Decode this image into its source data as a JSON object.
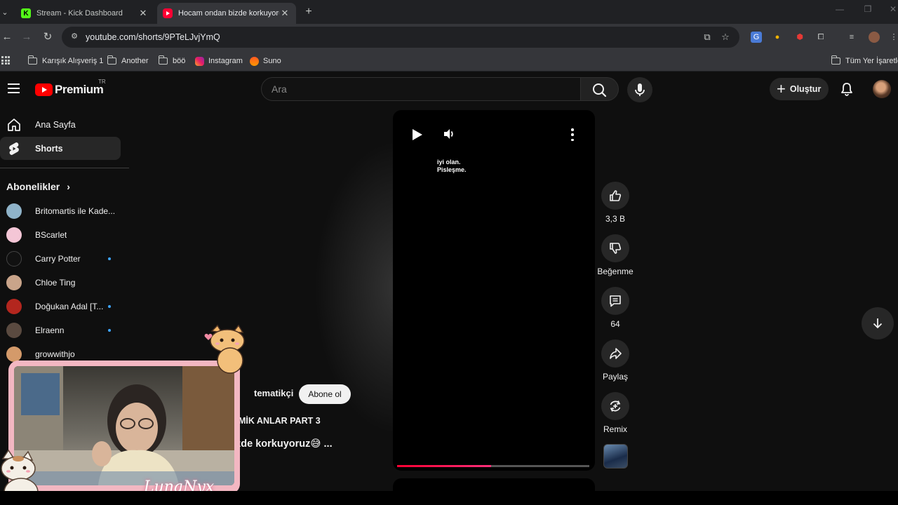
{
  "browser": {
    "tabs": [
      {
        "title": "Stream - Kick Dashboard",
        "active": false
      },
      {
        "title": "Hocam ondan bizde korkuyoruz",
        "active": true
      }
    ],
    "url": "youtube.com/shorts/9PTeLJvjYmQ",
    "bookmarks": [
      "Karışık Alışveriş 1",
      "Another",
      "böö",
      "Instagram",
      "Suno"
    ],
    "bookmarks_right": "Tüm Yer İşaretleri"
  },
  "youtube": {
    "logo_text": "Premium",
    "country_code": "TR",
    "search_placeholder": "Ara",
    "create_label": "Oluştur",
    "nav": [
      {
        "label": "Ana Sayfa",
        "icon": "home-icon",
        "active": false
      },
      {
        "label": "Shorts",
        "icon": "shorts-icon",
        "active": true
      }
    ],
    "subscriptions_heading": "Abonelikler",
    "subscriptions": [
      {
        "name": "Britomartis ile Kade...",
        "color": "#8fb3c9",
        "new": false
      },
      {
        "name": "BScarlet",
        "color": "#f4c6d6",
        "new": false
      },
      {
        "name": "Carry Potter",
        "color": "#111111",
        "new": true
      },
      {
        "name": "Chloe Ting",
        "color": "#c9a48a",
        "new": false
      },
      {
        "name": "Doğukan Adal [T...",
        "color": "#b3261e",
        "new": true
      },
      {
        "name": "Elraenn",
        "color": "#5a4a40",
        "new": true
      },
      {
        "name": "growwithjo",
        "color": "#d49a6a",
        "new": false
      }
    ],
    "short": {
      "caption_line1": "iyi olan.",
      "caption_line2": "Pisleşme.",
      "progress": 0.49,
      "channel": "tematikçi",
      "subscribe_label": "Abone ol",
      "playlist": "MİK ANLAR PART 3",
      "title": "izde korkuyoruz😅 ..."
    },
    "actions": {
      "like_count": "3,3 B",
      "dislike_label": "Beğenme",
      "comment_count": "64",
      "share_label": "Paylaş",
      "remix_label": "Remix"
    }
  },
  "overlay": {
    "streamer_signature": "LunaNyx"
  },
  "colors": {
    "accent_red": "#ff0033",
    "subscribe_bg": "#f1f1f1",
    "webcam_frame": "#f3b7c2"
  }
}
